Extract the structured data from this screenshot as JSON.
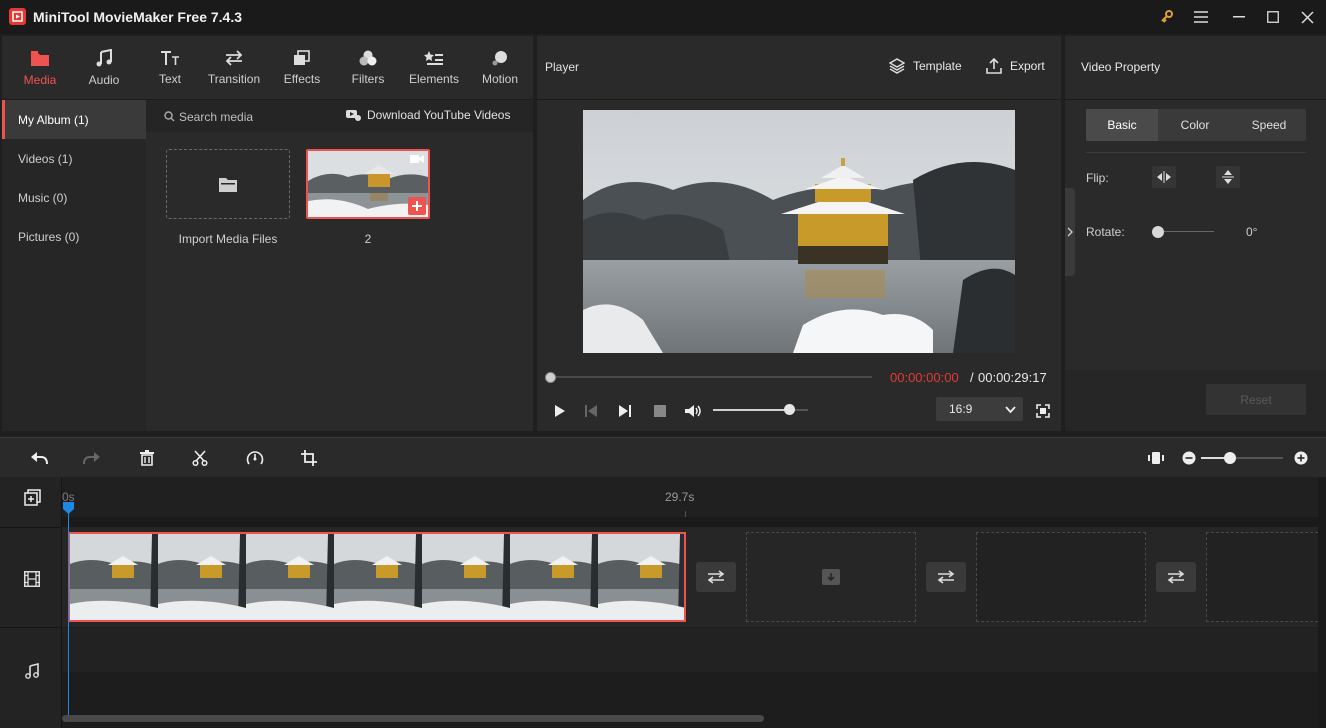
{
  "app": {
    "title": "MiniTool MovieMaker Free 7.4.3"
  },
  "toolbar": {
    "tabs": [
      {
        "label": "Media",
        "icon": "folder-icon"
      },
      {
        "label": "Audio",
        "icon": "music-note-icon"
      },
      {
        "label": "Text",
        "icon": "text-icon"
      },
      {
        "label": "Transition",
        "icon": "transition-arrows-icon"
      },
      {
        "label": "Effects",
        "icon": "effects-icon"
      },
      {
        "label": "Filters",
        "icon": "filters-icon"
      },
      {
        "label": "Elements",
        "icon": "elements-icon"
      },
      {
        "label": "Motion",
        "icon": "motion-icon"
      }
    ],
    "active_tab": "Media"
  },
  "album": {
    "items": [
      {
        "label": "My Album (1)"
      },
      {
        "label": "Videos (1)"
      },
      {
        "label": "Music (0)"
      },
      {
        "label": "Pictures (0)"
      }
    ],
    "active": "My Album (1)"
  },
  "media": {
    "search_placeholder": "Search media",
    "download_label": "Download YouTube Videos",
    "import_label": "Import Media Files",
    "clip_name": "2"
  },
  "player": {
    "title": "Player",
    "template_label": "Template",
    "export_label": "Export",
    "current_time": "00:00:00:00",
    "separator": "/",
    "total_time": "00:00:29:17",
    "aspect_ratio": "16:9",
    "progress": 0,
    "volume": 0.8
  },
  "properties": {
    "title": "Video Property",
    "tabs": [
      "Basic",
      "Color",
      "Speed"
    ],
    "active_tab": "Basic",
    "flip_label": "Flip:",
    "rotate_label": "Rotate:",
    "rotate_value": "0°",
    "reset_label": "Reset"
  },
  "timeline": {
    "ruler_start": "0s",
    "ruler_end": "29.7s",
    "zoom_level": 0.35
  },
  "colors": {
    "accent": "#ef5350",
    "playhead": "#1e88e5",
    "time_current": "#e53935"
  }
}
